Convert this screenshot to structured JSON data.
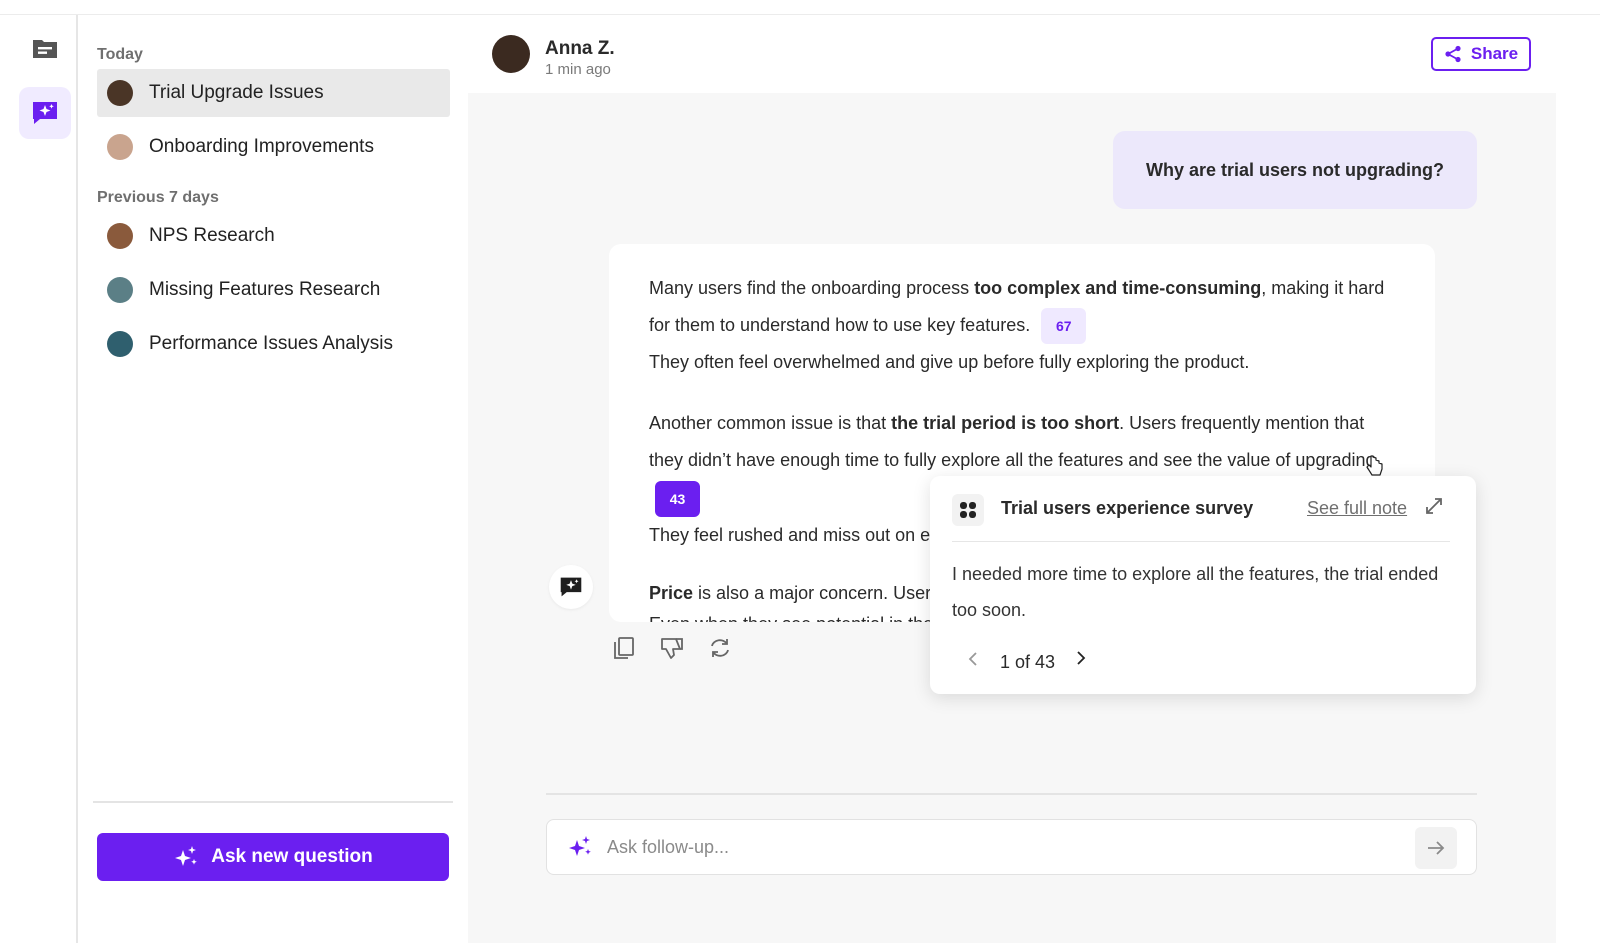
{
  "sidebar": {
    "sections": [
      {
        "label": "Today",
        "items": [
          {
            "label": "Trial Upgrade Issues",
            "active": true,
            "avatar_color": "#4a3526"
          },
          {
            "label": "Onboarding Improvements",
            "active": false,
            "avatar_color": "#c9a48e"
          }
        ]
      },
      {
        "label": "Previous 7 days",
        "items": [
          {
            "label": "NPS Research",
            "active": false,
            "avatar_color": "#8a5a3c"
          },
          {
            "label": "Missing Features Research",
            "active": false,
            "avatar_color": "#5b7f86"
          },
          {
            "label": "Performance Issues Analysis",
            "active": false,
            "avatar_color": "#2f5f6e"
          }
        ]
      }
    ],
    "ask_button_label": "Ask new question"
  },
  "header": {
    "user_name": "Anna Z.",
    "timestamp": "1 min ago",
    "share_label": "Share"
  },
  "chat": {
    "question": "Why are trial users not upgrading?",
    "answer": {
      "p1": {
        "t1": "Many users find the onboarding process ",
        "b1": "too complex and time-consuming",
        "t2": ", making it hard for them to understand how to use key features.",
        "cite": "67",
        "t3": "They often feel overwhelmed and give up before fully  exploring the product."
      },
      "p2": {
        "t1": "Another common issue is that ",
        "b1": "the trial period is too short",
        "t2": ". Users frequently mention that they didn’t have enough time to fully explore all the features and see the value of upgrading.",
        "cite": "43",
        "t3": "They feel  rushed and miss out on ex"
      },
      "p3": {
        "b1": "Price",
        "t1": " is also a major concern. Users",
        "t2": "Even when they see potential in the"
      }
    }
  },
  "popover": {
    "title": "Trial users experience survey",
    "link": "See full note",
    "quote": "I needed more time to explore all the features, the trial ended too soon.",
    "pagination": "1 of 43"
  },
  "followup": {
    "placeholder": "Ask follow-up..."
  },
  "colors": {
    "accent": "#6b1ff0",
    "accent_light": "#efe9ff",
    "question_bubble": "#ece8fb",
    "active_item": "#e9e9e9"
  },
  "icons": [
    "notes-icon",
    "ai-chat-icon",
    "share-icon",
    "sparkle-icon",
    "copy-icon",
    "thumbs-down-icon",
    "regenerate-icon",
    "source-logo-icon",
    "expand-icon",
    "chevron-left-icon",
    "chevron-right-icon",
    "arrow-right-icon",
    "cursor-icon"
  ]
}
